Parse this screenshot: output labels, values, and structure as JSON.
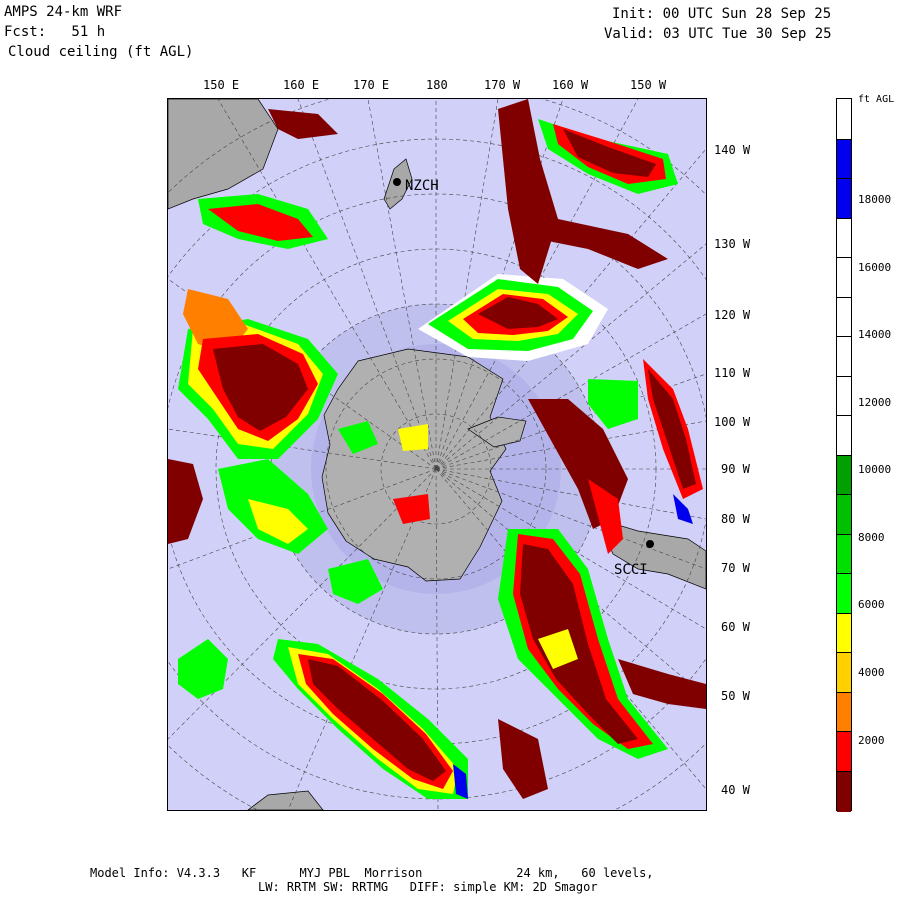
{
  "header": {
    "model": "AMPS 24-km WRF",
    "fcst": "Fcst:   51 h",
    "field": "Cloud ceiling (ft AGL)",
    "init": "Init: 00 UTC Sun 28 Sep 25",
    "valid": "Valid: 03 UTC Tue 30 Sep 25"
  },
  "map": {
    "top_lon_labels": [
      "150 E",
      "160 E",
      "170 E",
      "180",
      "170 W",
      "160 W",
      "150 W"
    ],
    "right_lon_labels": [
      "140 W",
      "130 W",
      "120 W",
      "110 W",
      "100 W",
      "90 W",
      "80 W",
      "70 W",
      "60 W",
      "50 W",
      "40 W"
    ],
    "stations": [
      {
        "name": "NZCH"
      },
      {
        "name": "SCCI"
      }
    ],
    "colors": {
      "background": "#d0d0f8",
      "land": "#a8a8a8",
      "icesheet": "#c0c0c0"
    }
  },
  "colorbar": {
    "unit_label": "ft AGL",
    "tick_labels": [
      "18000",
      "16000",
      "14000",
      "12000",
      "10000",
      "8000",
      "6000",
      "4000",
      "2000"
    ],
    "segments": [
      {
        "color": "#ffffff"
      },
      {
        "color": "#0000ee"
      },
      {
        "color": "#0000ee"
      },
      {
        "color": "#ffffff"
      },
      {
        "color": "#ffffff"
      },
      {
        "color": "#ffffff"
      },
      {
        "color": "#ffffff"
      },
      {
        "color": "#ffffff"
      },
      {
        "color": "#ffffff"
      },
      {
        "color": "#00a000"
      },
      {
        "color": "#00c000"
      },
      {
        "color": "#00e000"
      },
      {
        "color": "#00ff00"
      },
      {
        "color": "#ffff00"
      },
      {
        "color": "#ffd000"
      },
      {
        "color": "#ff8000"
      },
      {
        "color": "#ff0000"
      },
      {
        "color": "#800000"
      }
    ]
  },
  "footer": {
    "line1": "Model Info: V4.3.3   KF      MYJ PBL  Morrison             24 km,   60 levels,",
    "line2": "LW: RRTM SW: RRTMG   DIFF: simple KM: 2D Smagor"
  }
}
